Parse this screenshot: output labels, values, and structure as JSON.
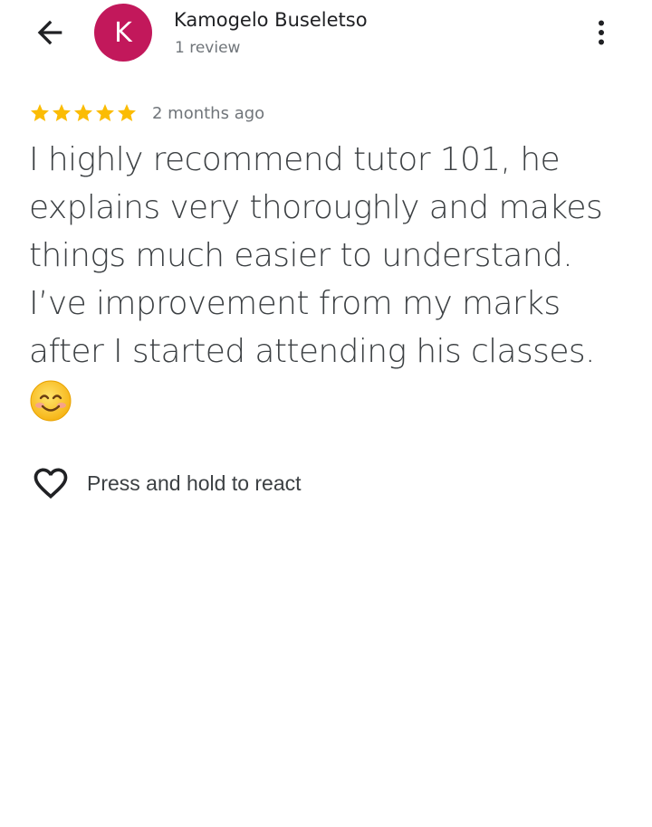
{
  "header": {
    "back_icon": "arrow-back-icon",
    "avatar_letter": "K",
    "avatar_color": "#c2185b",
    "reviewer_name": "Kamogelo Buseletso",
    "review_count": "1 review",
    "more_icon": "more-vert-icon"
  },
  "review": {
    "rating": 5,
    "rating_max": 5,
    "star_color": "#fbbc04",
    "date": "2 months ago",
    "text": "I highly recommend tutor 101, he explains very thoroughly and makes things much easier to understand. I’ve improvement from my marks after I started attending his classes.",
    "emoji_icon": "smiling-face-icon"
  },
  "reaction": {
    "icon": "heart-outline-icon",
    "label": "Press and hold to react"
  }
}
